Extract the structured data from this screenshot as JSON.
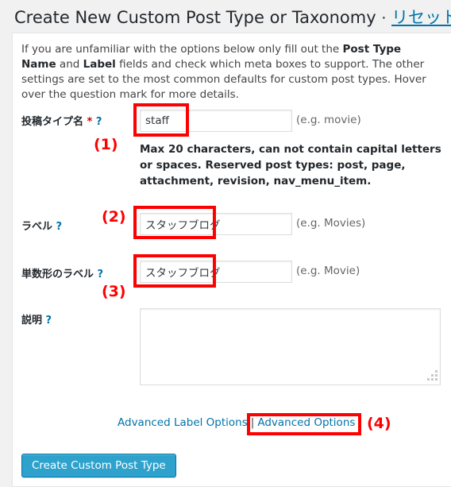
{
  "header": {
    "title": "Create New Custom Post Type or Taxonomy",
    "separator": "·",
    "reset_link": "リセット"
  },
  "intro": {
    "part1": "If you are unfamiliar with the options below only fill out the ",
    "bold1": "Post Type Name",
    "part2": " and ",
    "bold2": "Label",
    "part3": " fields and check which meta boxes to support. The other settings are set to the most common defaults for custom post types. Hover over the question mark for more details."
  },
  "fields": {
    "post_type_name": {
      "label": "投稿タイプ名",
      "required_mark": "*",
      "help_mark": "?",
      "value": "staff",
      "placeholder": "",
      "hint": "(e.g. movie)",
      "description": "Max 20 characters, can not contain capital letters or spaces. Reserved post types: post, page, attachment, revision, nav_menu_item."
    },
    "label": {
      "label": "ラベル",
      "help_mark": "?",
      "value": "スタッフブログ",
      "placeholder": "",
      "hint": "(e.g. Movies)"
    },
    "singular_label": {
      "label": "単数形のラベル",
      "help_mark": "?",
      "value": "スタッフブログ",
      "placeholder": "",
      "hint": "(e.g. Movie)"
    },
    "description": {
      "label": "説明",
      "help_mark": "?",
      "value": "",
      "placeholder": ""
    }
  },
  "links": {
    "advanced_label_options": "Advanced Label Options",
    "divider": "|",
    "advanced_options": "Advanced Options"
  },
  "submit": {
    "label": "Create Custom Post Type"
  },
  "annotations": {
    "one": "(1)",
    "two": "(2)",
    "three": "(3)",
    "four": "(4)"
  },
  "colors": {
    "annotation_red": "#ff0000",
    "link_blue": "#0073aa",
    "button_blue": "#2ea2cc",
    "required_red": "#cc0000",
    "page_background": "#f1f1f1"
  }
}
